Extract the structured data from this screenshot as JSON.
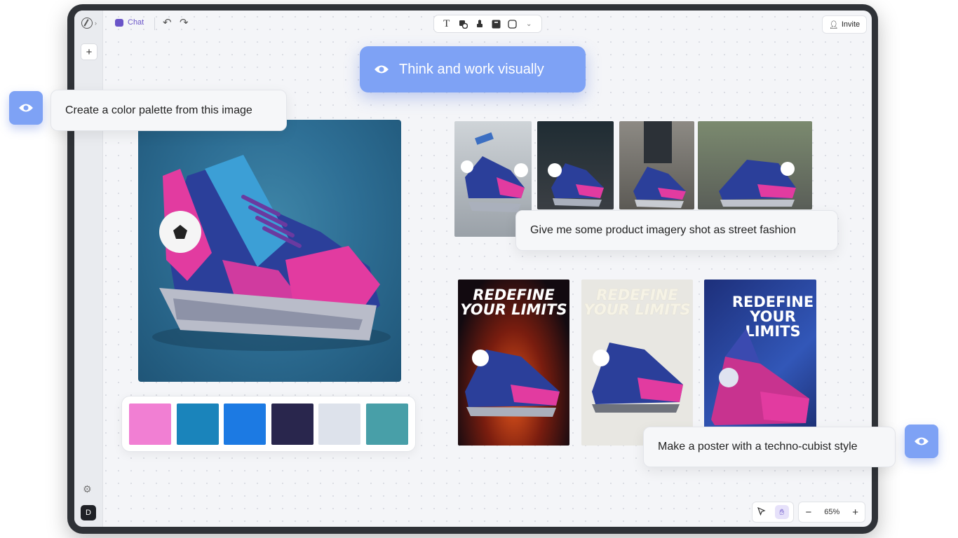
{
  "toolbar": {
    "chat_label": "Chat",
    "invite_label": "Invite",
    "tools": [
      "text-tool-icon",
      "shape-tool-icon",
      "pin-tool-icon",
      "sticky-tool-icon",
      "frame-tool-icon",
      "more-tools-icon"
    ]
  },
  "sidebar": {
    "avatar_initial": "D"
  },
  "zoom": {
    "level": "65%",
    "minus": "−",
    "plus": "+"
  },
  "headline": {
    "text": "Think and work visually"
  },
  "prompts": {
    "palette": "Create a color palette from this image",
    "street": "Give me some product imagery shot as street fashion",
    "poster": "Make a poster with a techno-cubist style"
  },
  "palette_colors": [
    "#f17fd3",
    "#1a84bb",
    "#1c7ae3",
    "#29264d",
    "#dde2eb",
    "#489fa8"
  ],
  "posters": {
    "line1": "REDEFINE",
    "line2": "YOUR LIMITS",
    "line2a": "YOUR",
    "line2b": "LIMITS"
  },
  "accent": "#7ea2f5"
}
